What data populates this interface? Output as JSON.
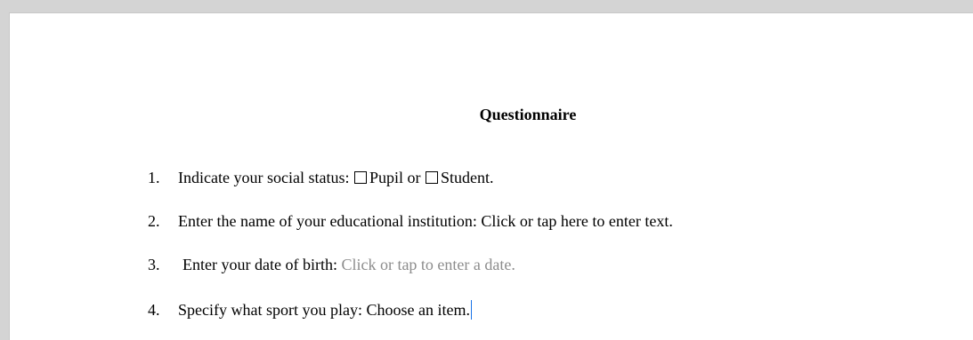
{
  "document": {
    "title": "Questionnaire",
    "items": [
      {
        "number": "1.",
        "text_before": "Indicate your social status:",
        "option1": "Pupil",
        "connector": "or",
        "option2": "Student."
      },
      {
        "number": "2.",
        "label": "Enter the name of your educational institution:",
        "control_text": "Click or tap here to enter text."
      },
      {
        "number": "3.",
        "label": "Enter your date of birth:",
        "control_text": "Click or tap to enter a date."
      },
      {
        "number": "4.",
        "label": "Specify what sport you play:",
        "control_text": "Choose an item."
      }
    ]
  },
  "colors": {
    "placeholder": "#8c8c8c",
    "caret": "#1a73e8"
  }
}
